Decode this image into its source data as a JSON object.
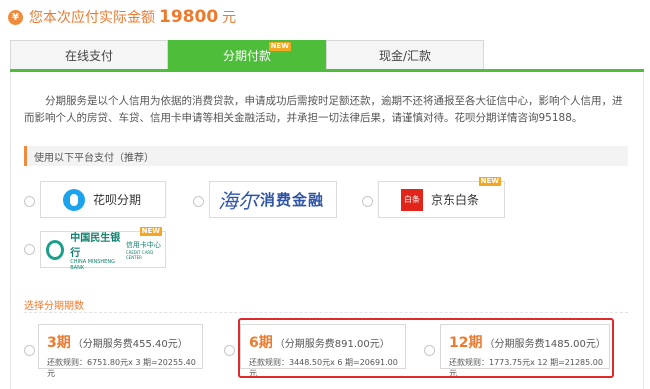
{
  "header": {
    "currency_icon": "yen-icon",
    "amount_label": "您本次应付实际金额",
    "amount_value": "19800",
    "amount_unit": "元"
  },
  "tabs": [
    {
      "label": "在线支付",
      "active": false
    },
    {
      "label": "分期付款",
      "active": true,
      "badge": "NEW"
    },
    {
      "label": "现金/汇款",
      "active": false
    }
  ],
  "description": "分期服务是以个人信用为依据的消费贷款，申请成功后需按时足额还款，逾期不还将通报至各大征信中心，影响个人信用，进而影响个人的房贷、车贷、信用卡申请等相关金融活动，并承担一切法律后果，请谨慎对待。花呗分期详情咨询95188。",
  "platform_section": {
    "title": "使用以下平台支付（推荐）",
    "platforms": [
      {
        "name": "花呗分期",
        "icon": "huabei-icon"
      },
      {
        "name": "海尔消费金融",
        "logo_text": "海尔",
        "label": "消费金融",
        "icon": "haier-logo"
      },
      {
        "name": "京东白条",
        "icon_text": "白条",
        "badge": "NEW",
        "icon": "jd-baitiao-icon"
      },
      {
        "name": "中国民生银行",
        "en": "CHINA MINSHENG BANK",
        "sub": "信用卡中心",
        "sub_en": "CREDIT CARD CENTER",
        "badge": "NEW",
        "icon": "minsheng-logo"
      }
    ]
  },
  "periods_section": {
    "title": "选择分期期数",
    "options": [
      {
        "period": "3期",
        "fee": "（分期服务费455.40元）",
        "rule": "还款规则：6751.80元x 3 期=20255.40元"
      },
      {
        "period": "6期",
        "fee": "（分期服务费891.00元）",
        "rule": "还款规则：3448.50元x 6 期=20691.00元"
      },
      {
        "period": "12期",
        "fee": "（分期服务费1485.00元）",
        "rule": "还款规则：1773.75元x 12 期=21285.00元"
      }
    ]
  },
  "colors": {
    "accent_green": "#4dbd3a",
    "accent_orange": "#ee7a2f",
    "highlight_red": "#e02a2a",
    "badge_orange": "#f5a623"
  }
}
